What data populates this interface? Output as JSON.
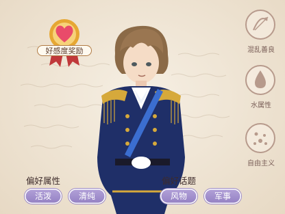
{
  "reward_badge": {
    "label": "好感度奖励"
  },
  "traits": [
    {
      "label": "混乱善良",
      "icon": "bow-arrow-icon"
    },
    {
      "label": "水属性",
      "icon": "water-drop-icon"
    },
    {
      "label": "自由主义",
      "icon": "stars-icon"
    }
  ],
  "preferred_attributes": {
    "title": "偏好属性",
    "tags": [
      "活泼",
      "清纯"
    ]
  },
  "preferred_topics": {
    "title": "偏好话题",
    "tags": [
      "风物",
      "军事"
    ]
  },
  "colors": {
    "background": "#efe6d8",
    "pill": "#a492cf",
    "trait_outline": "#b79a8c",
    "heart": "#e94b6a",
    "badge_gold": "#e6a733"
  }
}
